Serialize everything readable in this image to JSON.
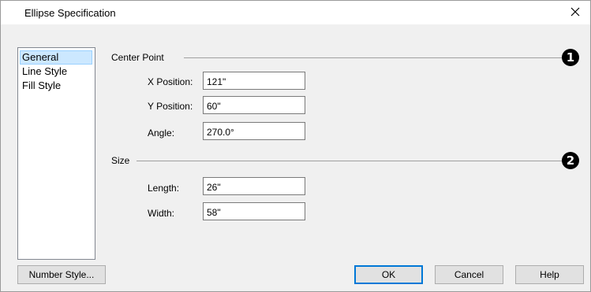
{
  "window": {
    "title": "Ellipse Specification"
  },
  "nav": {
    "items": [
      {
        "label": "General",
        "selected": true
      },
      {
        "label": "Line Style",
        "selected": false
      },
      {
        "label": "Fill Style",
        "selected": false
      }
    ]
  },
  "center_point": {
    "label": "Center Point",
    "badge": "1",
    "x_label": "X Position:",
    "x_value": "121\"",
    "y_label": "Y Position:",
    "y_value": "60\"",
    "angle_label": "Angle:",
    "angle_value": "270.0°"
  },
  "size": {
    "label": "Size",
    "badge": "2",
    "length_label": "Length:",
    "length_value": "26\"",
    "width_label": "Width:",
    "width_value": "58\""
  },
  "buttons": {
    "number_style": "Number Style...",
    "ok": "OK",
    "cancel": "Cancel",
    "help": "Help"
  },
  "colors": {
    "selection": "#cce8ff",
    "default_button_border": "#0078d7"
  }
}
